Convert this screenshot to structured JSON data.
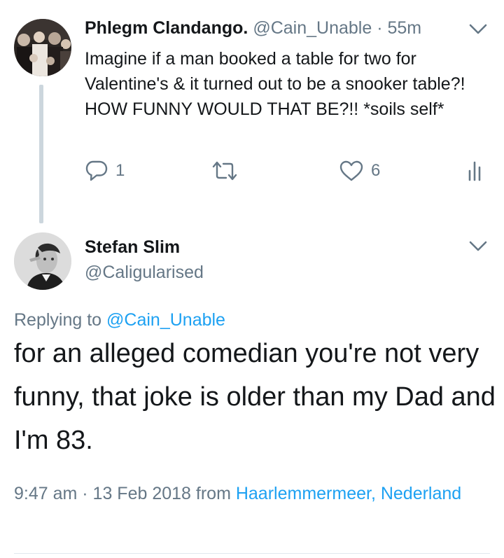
{
  "tweet1": {
    "display_name": "Phlegm Clandango.",
    "handle": "@Cain_Unable",
    "separator": "·",
    "time": "55m",
    "text": "Imagine if a man booked a table for two for Valentine's & it turned out to be a snooker table?! HOW FUNNY WOULD THAT BE?!! *soils self*",
    "actions": {
      "reply_icon": "reply-icon",
      "reply_count": "1",
      "retweet_icon": "retweet-icon",
      "like_icon": "heart-icon",
      "like_count": "6",
      "analytics_icon": "analytics-icon"
    }
  },
  "tweet2": {
    "display_name": "Stefan Slim",
    "handle": "@Caligularised",
    "replying_prefix": "Replying to",
    "replying_handle": "@Cain_Unable",
    "text": "for an alleged comedian you're not very funny, that joke is older than my Dad and I'm 83.",
    "timestamp": "9:47 am · 13 Feb 2018 from",
    "location": "Haarlemmermeer, Nederland"
  },
  "colors": {
    "text": "#14171a",
    "secondary": "#657786",
    "link": "#1da1f2",
    "thread_line": "#ccd6dd"
  }
}
